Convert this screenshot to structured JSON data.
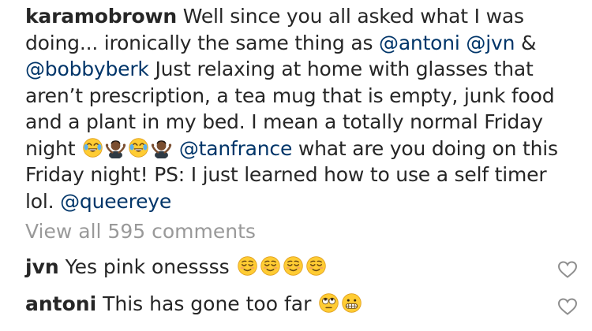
{
  "post": {
    "username": "karamobrown",
    "caption_parts": {
      "p1": " Well since you all asked what I was doing... ironically the same thing as ",
      "m1": "@antoni",
      "p2": " ",
      "m2": "@jvn",
      "p3": " & ",
      "m3": "@bobbyberk",
      "p4": " Just relaxing at home with glasses that aren’t prescription, a tea mug that is empty,  junk food and a plant in my bed. I mean a totally normal Friday night ",
      "p5": " ",
      "m4": "@tanfrance",
      "p6": " what are you doing on this Friday night! PS: I just learned how to use a self timer lol. ",
      "m5": "@queereye"
    },
    "caption_emojis": [
      "face-with-tears-of-joy",
      "person-shrugging",
      "face-with-tears-of-joy",
      "person-shrugging"
    ]
  },
  "comments_section": {
    "view_all_label": "View all 595 comments",
    "comments": [
      {
        "user": "jvn",
        "text": " Yes pink onessss ",
        "emojis": [
          "relieved-face",
          "relieved-face",
          "relieved-face",
          "relieved-face"
        ]
      },
      {
        "user": "antoni",
        "text": " This has gone too far ",
        "emojis": [
          "face-with-rolling-eyes",
          "grimacing-face"
        ]
      }
    ]
  },
  "colors": {
    "text": "#262626",
    "mention": "#003569",
    "muted": "#999999",
    "heart_outline": "#8e8e8e"
  }
}
